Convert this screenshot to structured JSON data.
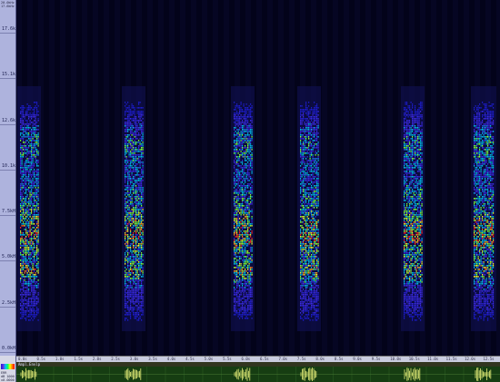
{
  "app": {
    "top_info": "20.0kHz\n17.6kHz",
    "panel_info": "ERR\ndB 1000\nx0.0000"
  },
  "freq_axis": {
    "labels": [
      "17.6kHz",
      "15.1kHz",
      "12.6kHz",
      "10.1kHz",
      "7.5kHz",
      "5.0kHz",
      "2.5kHz",
      "0.0kHz"
    ]
  },
  "time_ruler": {
    "labels": [
      "0.0s",
      "0.5s",
      "1.0s",
      "1.5s",
      "2.0s",
      "2.5s",
      "3.0s",
      "3.5s",
      "4.0s",
      "4.5s",
      "5.0s",
      "5.5s",
      "6.0s",
      "6.5s",
      "7.0s",
      "7.5s",
      "8.0s",
      "8.5s",
      "9.0s",
      "9.5s",
      "10.0s",
      "10.5s",
      "11.0s",
      "11.5s",
      "12.0s",
      "12.5s"
    ]
  },
  "waveform": {
    "track_label": "Ampl.Envlp"
  },
  "colors": {
    "background": "#03031a",
    "axis_panel": "#aeb3dd",
    "waveform_bg": "#163d12",
    "waveform_signal": "#e8f07a",
    "scale_low": "#1b1bd6",
    "scale_mid": "#00ff66",
    "scale_high": "#ff0000"
  }
}
